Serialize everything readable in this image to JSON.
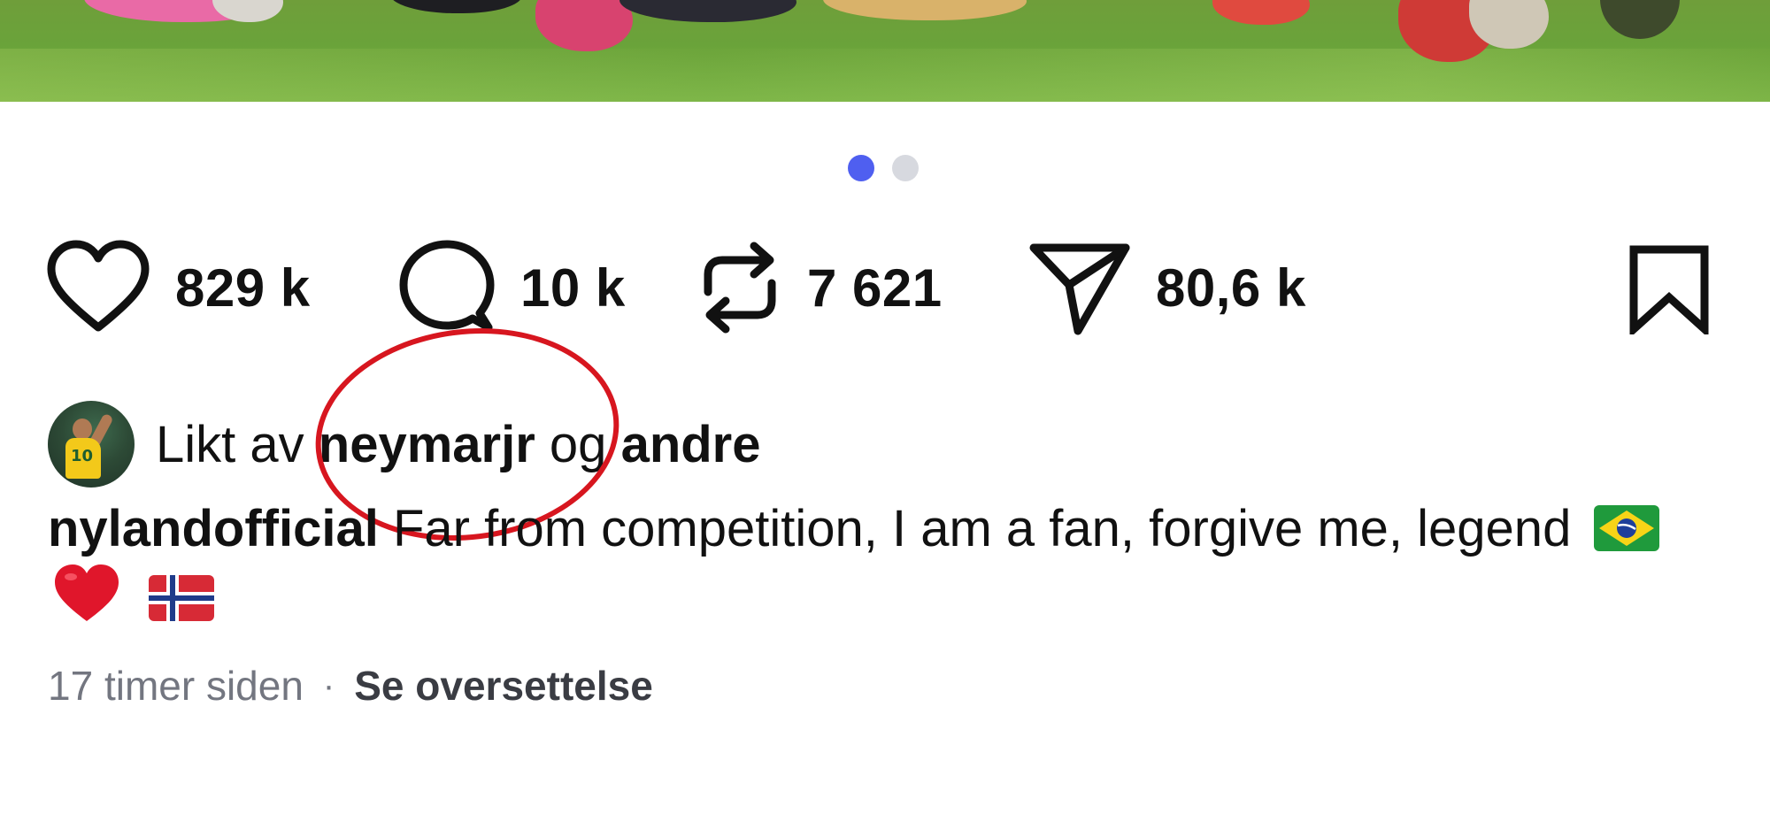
{
  "post": {
    "carousel": {
      "total": 2,
      "active_index": 0
    },
    "actions": {
      "likes": "829 k",
      "comments": "10 k",
      "reposts": "7 621",
      "shares": "80,6 k"
    },
    "liked_by": {
      "prefix": "Likt av",
      "user": "neymarjr",
      "conjunction": "og",
      "others": "andre"
    },
    "caption": {
      "username": "nylandofficial",
      "text": "Far from competition, I am a fan, forgive me, legend"
    },
    "meta": {
      "time": "17 timer siden",
      "separator": "·",
      "translate_label": "Se oversettelse"
    }
  },
  "colors": {
    "accent_dot": "#4f5ff0",
    "annotation": "#d7161f",
    "muted_text": "#737680"
  },
  "icons": [
    "heart-icon",
    "comment-icon",
    "repost-icon",
    "share-icon",
    "bookmark-icon"
  ]
}
